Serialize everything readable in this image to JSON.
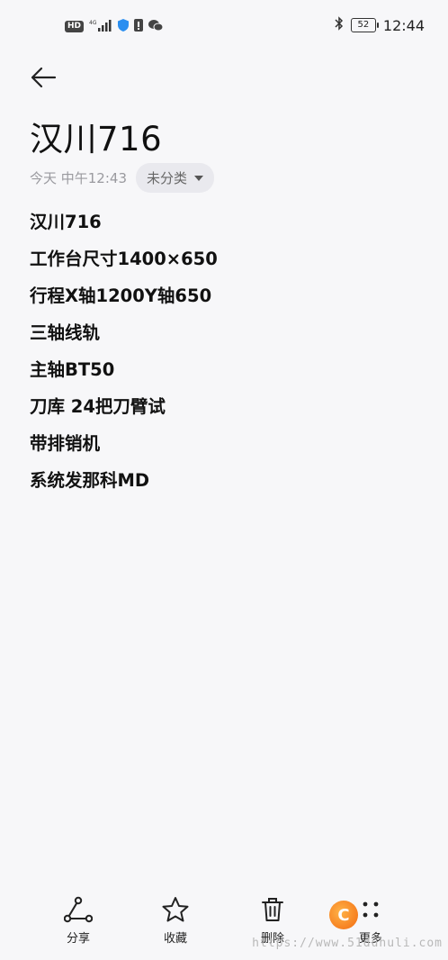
{
  "status_bar": {
    "network_badge": "HD",
    "network_type": "4G",
    "battery_level": "52",
    "time": "12:44"
  },
  "note": {
    "title": "汉川716",
    "date": "今天 中午12:43",
    "category": "未分类",
    "lines": [
      "汉川716",
      "工作台尺寸1400×650",
      "行程X轴1200Y轴650",
      "三轴线轨",
      "主轴BT50",
      "刀库 24把刀臂试",
      "带排销机",
      "系统发那科MD"
    ]
  },
  "toolbar": {
    "share_label": "分享",
    "favorite_label": "收藏",
    "delete_label": "删除",
    "more_label": "更多"
  },
  "watermark": {
    "text": "https://www.51duhuli.com",
    "logo_letter": "C"
  }
}
